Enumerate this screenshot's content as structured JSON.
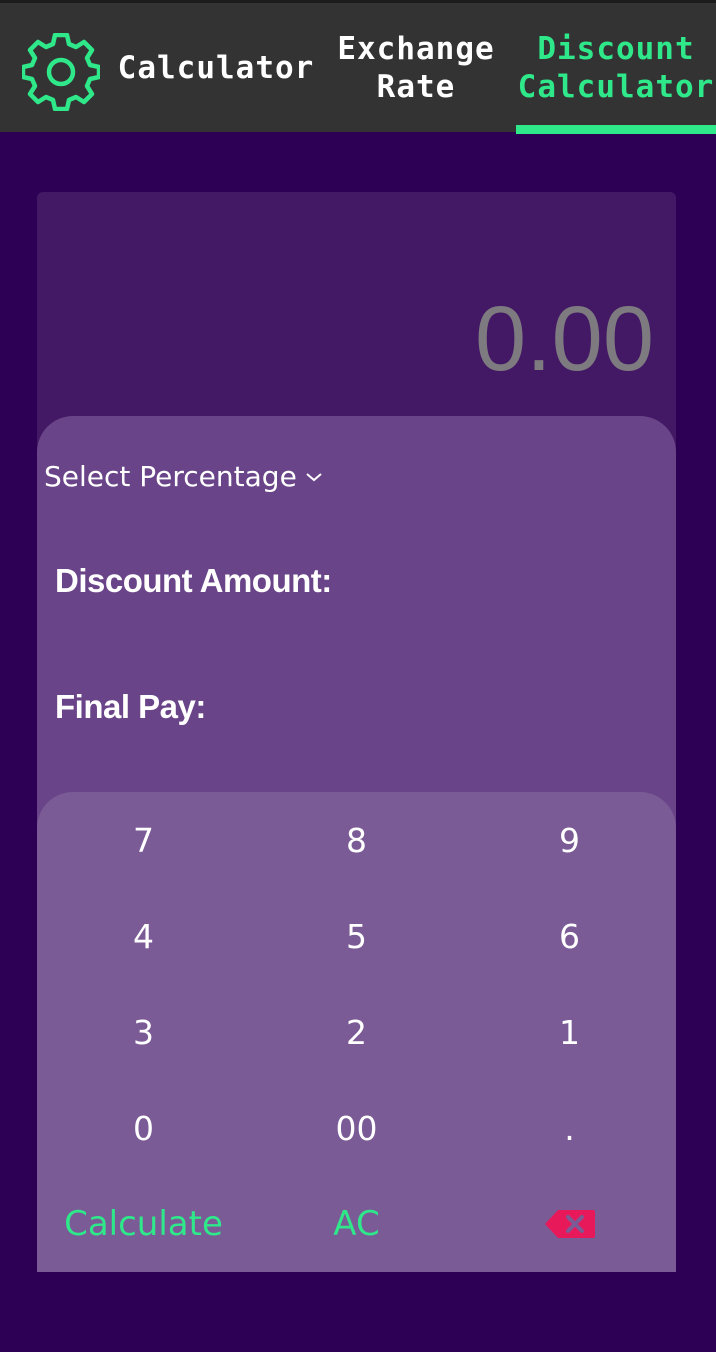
{
  "tabs": {
    "calculator": "Calculator",
    "exchange_rate_line1": "Exchange",
    "exchange_rate_line2": "Rate",
    "discount_line1": "Discount",
    "discount_line2": "Calculator",
    "active": "discount"
  },
  "icons": {
    "settings": "gear-icon",
    "dropdown": "chevron-down-icon",
    "backspace": "backspace-icon"
  },
  "display": {
    "value": "0.00"
  },
  "info": {
    "select_percentage": "Select Percentage",
    "discount_amount_label": "Discount Amount:",
    "final_pay_label": "Final Pay:"
  },
  "keypad": {
    "rows": [
      [
        "7",
        "8",
        "9"
      ],
      [
        "4",
        "5",
        "6"
      ],
      [
        "3",
        "2",
        "1"
      ],
      [
        "0",
        "00",
        "."
      ]
    ],
    "calculate": "Calculate",
    "clear": "AC"
  },
  "colors": {
    "accent": "#2ee88a",
    "background": "#2d0055",
    "topbar": "#333333",
    "display_panel": "#431864",
    "info_panel": "#6a4489",
    "keypad": "#7a5b96",
    "backspace": "#e8195a"
  }
}
